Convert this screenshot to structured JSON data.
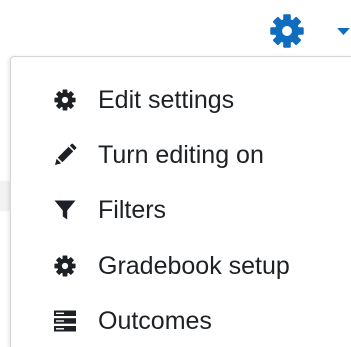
{
  "toggle": {
    "icon": "gear-icon",
    "caret_icon": "caret-down-icon",
    "accent_color": "#0f6cbf"
  },
  "menu": {
    "items": [
      {
        "label": "Edit settings",
        "icon": "gear-icon"
      },
      {
        "label": "Turn editing on",
        "icon": "pencil-icon"
      },
      {
        "label": "Filters",
        "icon": "filter-icon"
      },
      {
        "label": "Gradebook setup",
        "icon": "gear-icon"
      },
      {
        "label": "Outcomes",
        "icon": "outcomes-icon"
      }
    ]
  }
}
